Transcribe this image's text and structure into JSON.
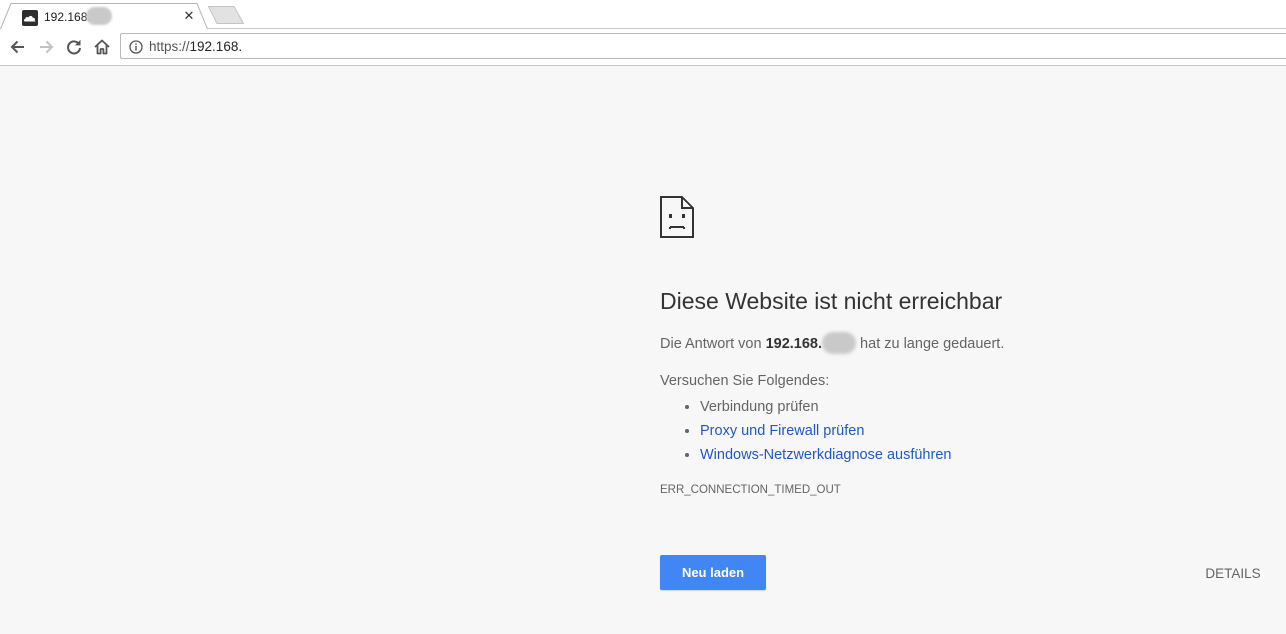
{
  "tab": {
    "title": "192.168.",
    "favicon": "cloud-favicon-icon",
    "close_glyph": "✕"
  },
  "toolbar": {
    "back": "back-arrow-icon",
    "forward": "forward-arrow-icon",
    "reload": "reload-icon",
    "home": "home-icon",
    "url_scheme": "https://",
    "url_host": "192.168."
  },
  "error": {
    "heading": "Diese Website ist nicht erreichbar",
    "summary_prefix": "Die Antwort von ",
    "summary_host": "192.168.",
    "summary_suffix": " hat zu lange gedauert.",
    "suggestions_heading": "Versuchen Sie Folgendes:",
    "suggestions": [
      {
        "label": "Verbindung prüfen",
        "link": false
      },
      {
        "label": "Proxy und Firewall prüfen",
        "link": true
      },
      {
        "label": "Windows-Netzwerkdiagnose ausführen",
        "link": true
      }
    ],
    "code": "ERR_CONNECTION_TIMED_OUT",
    "reload_label": "Neu laden",
    "details_label": "DETAILS"
  },
  "colors": {
    "page_bg": "#f7f7f7",
    "primary_button": "#4285f4",
    "link": "#1f58c8",
    "text": "#646464",
    "heading": "#333333"
  }
}
